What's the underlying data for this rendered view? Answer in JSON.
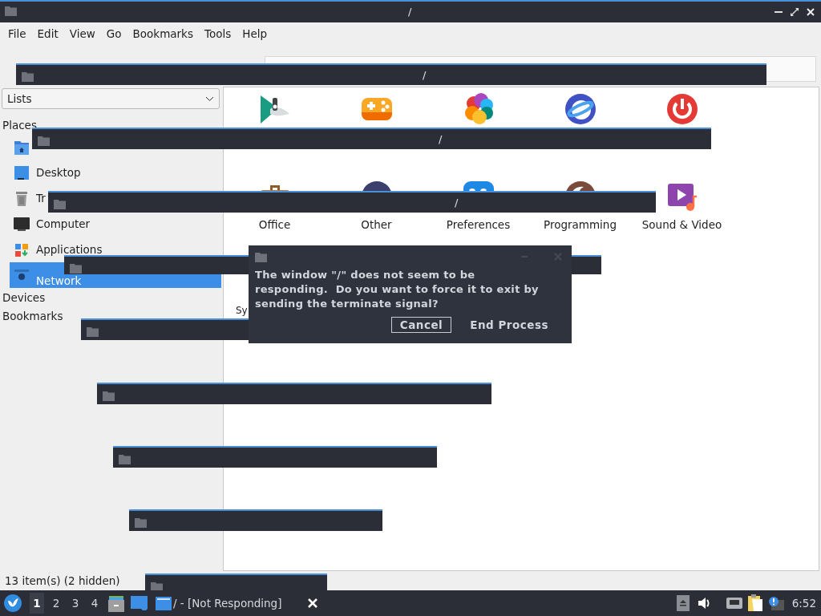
{
  "window": {
    "title": "/"
  },
  "menu": [
    "File",
    "Edit",
    "View",
    "Go",
    "Bookmarks",
    "Tools",
    "Help"
  ],
  "sidebar": {
    "selector": "Lists",
    "sections": [
      {
        "title": "Places",
        "items": [
          {
            "kind": "home",
            "selected": false
          },
          {
            "kind": "desktop",
            "label": "Desktop",
            "selected": false
          },
          {
            "kind": "trash",
            "label": "Tr",
            "selected": false
          },
          {
            "kind": "computer",
            "label": "Computer",
            "selected": false
          },
          {
            "kind": "applications",
            "label": "Applications",
            "selected": false
          },
          {
            "kind": "network",
            "label": "Network",
            "selected": true
          }
        ]
      },
      {
        "title": "Devices"
      },
      {
        "title": "Bookmarks"
      }
    ]
  },
  "files": [
    {
      "kind": "devtools"
    },
    {
      "kind": "games"
    },
    {
      "kind": "graphics"
    },
    {
      "kind": "internet"
    },
    {
      "kind": "leave"
    },
    {
      "kind": "office",
      "label": "Office"
    },
    {
      "kind": "other",
      "label": "Other"
    },
    {
      "kind": "preferences",
      "label": "Preferences"
    },
    {
      "kind": "programming",
      "label": "Programming"
    },
    {
      "kind": "sound",
      "label": "Sound & Video"
    },
    {
      "kind": "cut",
      "label": "Sy"
    }
  ],
  "status_bar": "13 item(s) (2 hidden)",
  "ghost_windows": [
    {
      "kind": "titled",
      "title": "/"
    },
    {
      "kind": "titled",
      "title": "/"
    },
    {
      "kind": "titled",
      "title": "/"
    },
    {
      "kind": "untitled"
    },
    {
      "kind": "untitled"
    },
    {
      "kind": "untitled"
    },
    {
      "kind": "untitled"
    },
    {
      "kind": "untitled"
    },
    {
      "kind": "untitled"
    }
  ],
  "dialog": {
    "message": "The window \"/\" does not seem to be\nresponding.  Do you want to force it to exit by\nsending the terminate signal?",
    "buttons": [
      {
        "label": "Cancel",
        "selected": true
      },
      {
        "label": "End Process",
        "selected": false
      }
    ]
  },
  "taskbar": {
    "desktops": [
      {
        "label": "1",
        "selected": true
      },
      {
        "label": "2",
        "selected": false
      },
      {
        "label": "3",
        "selected": false
      },
      {
        "label": "4",
        "selected": false
      }
    ],
    "task": "/ - [Not Responding]",
    "clock": "6:52"
  }
}
